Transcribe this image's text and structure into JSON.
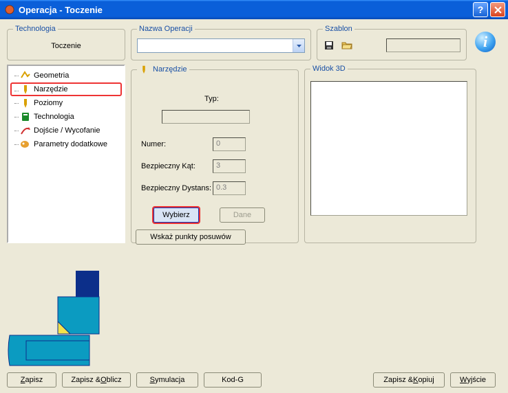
{
  "window": {
    "title": "Operacja - Toczenie"
  },
  "top": {
    "technologia_legend": "Technologia",
    "technologia_value": "Toczenie",
    "nazwa_legend": "Nazwa Operacji",
    "nazwa_value": "",
    "szablon_legend": "Szablon",
    "szablon_value": ""
  },
  "tree": {
    "items": [
      {
        "label": "Geometria",
        "icon": "geometry-icon",
        "selected": false
      },
      {
        "label": "Narzędzie",
        "icon": "tool-icon",
        "selected": true
      },
      {
        "label": "Poziomy",
        "icon": "levels-icon",
        "selected": false
      },
      {
        "label": "Technologia",
        "icon": "technology-icon",
        "selected": false
      },
      {
        "label": "Dojście / Wycofanie",
        "icon": "approach-icon",
        "selected": false
      },
      {
        "label": "Parametry dodatkowe",
        "icon": "params-icon",
        "selected": false
      }
    ]
  },
  "tool": {
    "legend": "Narzędzie",
    "typ_label": "Typ:",
    "typ_value": "",
    "numer_label": "Numer:",
    "numer_value": "0",
    "kat_label": "Bezpieczny Kąt:",
    "kat_value": "3",
    "dyst_label": "Bezpieczny Dystans:",
    "dyst_value": "0.3",
    "wybierz_label": "Wybierz",
    "dane_label": "Dane",
    "wskaz_label": "Wskaż punkty posuwów"
  },
  "view3d": {
    "legend": "Widok 3D"
  },
  "buttons": {
    "zapisz": "Zapisz",
    "zapisz_oblicz": "Zapisz & Oblicz",
    "symulacja": "Symulacja",
    "kodg": "Kod-G",
    "zapisz_kopiuj": "Zapisz & Kopiuj",
    "wyjscie": "Wyjście"
  }
}
